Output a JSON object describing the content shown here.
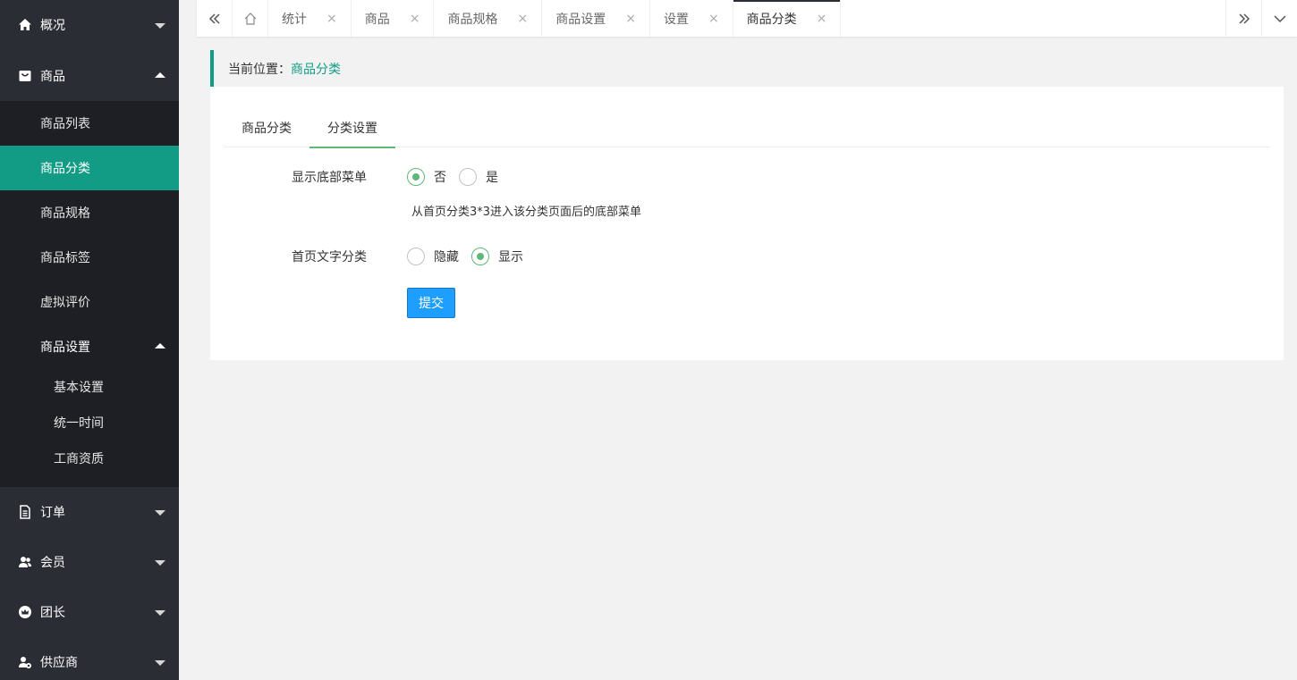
{
  "sidebar": {
    "overview": {
      "label": "概况",
      "icon": "home-icon"
    },
    "goods": {
      "label": "商品",
      "icon": "goods-icon",
      "items": [
        {
          "label": "商品列表"
        },
        {
          "label": "商品分类"
        },
        {
          "label": "商品规格"
        },
        {
          "label": "商品标签"
        },
        {
          "label": "虚拟评价"
        }
      ],
      "settings": {
        "label": "商品设置",
        "items": [
          {
            "label": "基本设置"
          },
          {
            "label": "统一时间"
          },
          {
            "label": "工商资质"
          }
        ]
      }
    },
    "order": {
      "label": "订单",
      "icon": "document-icon"
    },
    "member": {
      "label": "会员",
      "icon": "users-icon"
    },
    "leader": {
      "label": "团长",
      "icon": "crown-icon"
    },
    "supplier": {
      "label": "供应商",
      "icon": "supplier-icon"
    }
  },
  "tabbar": {
    "tabs": [
      {
        "label": "统计"
      },
      {
        "label": "商品"
      },
      {
        "label": "商品规格"
      },
      {
        "label": "商品设置"
      },
      {
        "label": "设置"
      },
      {
        "label": "商品分类"
      }
    ],
    "close_glyph": "×"
  },
  "location": {
    "label": "当前位置：",
    "value": "商品分类"
  },
  "content_tabs": [
    {
      "label": "商品分类"
    },
    {
      "label": "分类设置"
    }
  ],
  "form": {
    "bottom_menu": {
      "label": "显示底部菜单",
      "options": [
        {
          "label": "否"
        },
        {
          "label": "是"
        }
      ],
      "selected": "否",
      "help": "从首页分类3*3进入该分类页面后的底部菜单"
    },
    "home_text_category": {
      "label": "首页文字分类",
      "options": [
        {
          "label": "隐藏"
        },
        {
          "label": "显示"
        }
      ],
      "selected": "显示"
    },
    "submit_label": "提交"
  },
  "colors": {
    "sidebar_bg": "#2a2d33",
    "active_green": "#129c86",
    "radio_green": "#5fb878",
    "button_blue": "#1e9fff"
  }
}
